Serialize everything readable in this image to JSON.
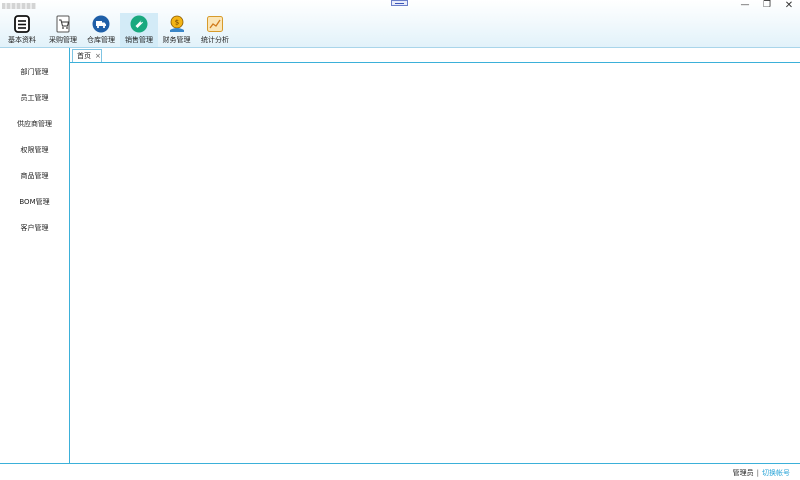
{
  "window": {
    "controls": {
      "minimize": "—",
      "maximize": "❐",
      "close": "✕"
    }
  },
  "toolbar": {
    "items": [
      {
        "label": "基本资料",
        "icon": "list-icon"
      },
      {
        "label": "采购管理",
        "icon": "cart-icon"
      },
      {
        "label": "仓库管理",
        "icon": "truck-icon"
      },
      {
        "label": "销售管理",
        "icon": "tag-icon",
        "active": true
      },
      {
        "label": "财务管理",
        "icon": "money-icon"
      },
      {
        "label": "统计分析",
        "icon": "chart-icon"
      }
    ]
  },
  "sidebar": {
    "items": [
      {
        "label": "部门管理"
      },
      {
        "label": "员工管理"
      },
      {
        "label": "供应商管理"
      },
      {
        "label": "权限管理"
      },
      {
        "label": "商品管理"
      },
      {
        "label": "BOM管理"
      },
      {
        "label": "客户管理"
      }
    ]
  },
  "tabs": [
    {
      "label": "首页",
      "close": "×"
    }
  ],
  "status": {
    "user": "管理员",
    "separator": "|",
    "switch_account": "切换帐号"
  },
  "colors": {
    "accent": "#3bb0d9",
    "toolbar_active": "#d3ebf7",
    "link": "#2aa5d8"
  }
}
